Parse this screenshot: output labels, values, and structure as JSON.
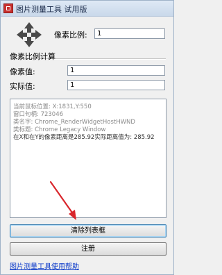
{
  "window": {
    "title": "图片测量工具 试用版"
  },
  "calibration": {
    "ratio_label": "像素比例:",
    "ratio_value": "1",
    "section_title": "像素比例计算",
    "pixel_label": "像素值:",
    "pixel_value": "1",
    "actual_label": "实际值:",
    "actual_value": "1"
  },
  "log": {
    "lines": [
      "当前鼠标位置: X:1831,Y:550",
      "窗口句柄: 723046",
      "类名字: Chrome_RenderWidgetHostHWND",
      "类标题: Chrome Legacy Window",
      "在X和在Y的像素距离是285.92实际距离值为: 285.92"
    ]
  },
  "buttons": {
    "clear_list": "清除列表框",
    "register": "注册"
  },
  "footer": {
    "help_link": "图片测量工具使用帮助"
  },
  "colors": {
    "annotation_arrow": "#d9262c",
    "link": "#0a39c9"
  }
}
